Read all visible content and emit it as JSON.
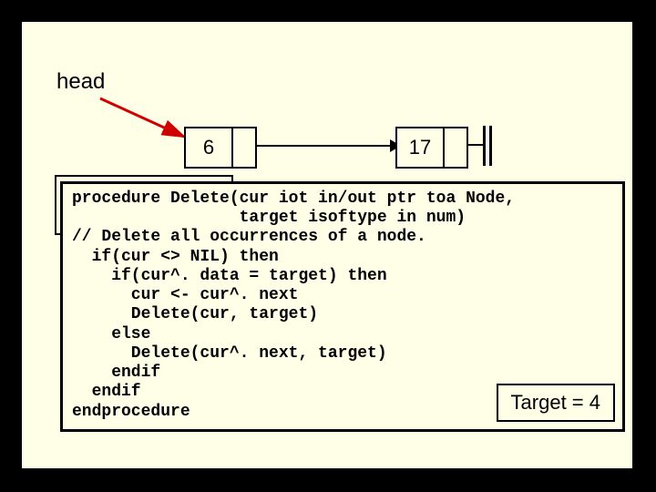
{
  "head_label": "head",
  "nodes": {
    "first": "6",
    "second": "17"
  },
  "code": "procedure Delete(cur iot in/out ptr toa Node,\n                 target isoftype in num)\n// Delete all occurrences of a node.\n  if(cur <> NIL) then\n    if(cur^. data = target) then\n      cur <- cur^. next\n      Delete(cur, target)\n    else\n      Delete(cur^. next, target)\n    endif\n  endif\nendprocedure",
  "target_label": "Target = 4",
  "chart_data": {
    "type": "table",
    "title": "Linked-list Delete procedure illustration",
    "linked_list": [
      {
        "data": 6,
        "next": "node2"
      },
      {
        "data": 17,
        "next": "NIL"
      }
    ],
    "target_value": 4,
    "procedure_name": "Delete",
    "procedure_signature": "Delete(cur iot in/out ptr toa Node, target isoftype in num)"
  }
}
